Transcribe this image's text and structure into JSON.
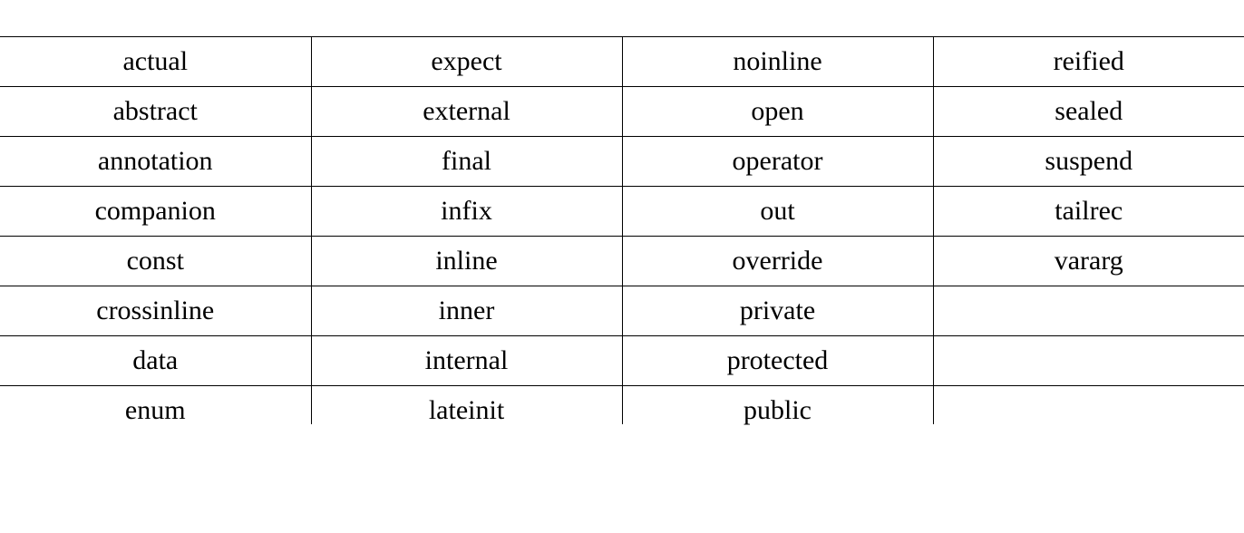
{
  "table": {
    "rows": [
      [
        "actual",
        "expect",
        "noinline",
        "reified"
      ],
      [
        "abstract",
        "external",
        "open",
        "sealed"
      ],
      [
        "annotation",
        "final",
        "operator",
        "suspend"
      ],
      [
        "companion",
        "infix",
        "out",
        "tailrec"
      ],
      [
        "const",
        "inline",
        "override",
        "vararg"
      ],
      [
        "crossinline",
        "inner",
        "private",
        ""
      ],
      [
        "data",
        "internal",
        "protected",
        ""
      ],
      [
        "enum",
        "lateinit",
        "public",
        ""
      ]
    ]
  }
}
